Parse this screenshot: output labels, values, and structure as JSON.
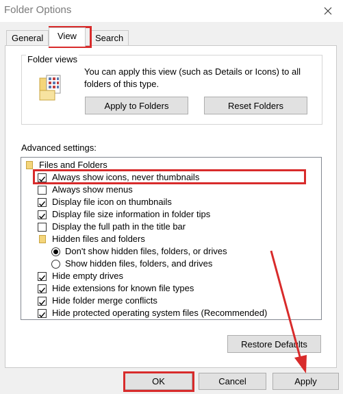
{
  "window": {
    "title": "Folder Options"
  },
  "tabs": [
    {
      "label": "General"
    },
    {
      "label": "View"
    },
    {
      "label": "Search"
    }
  ],
  "folder_views": {
    "legend": "Folder views",
    "description": "You can apply this view (such as Details or Icons) to all folders of this type.",
    "apply_button": "Apply to Folders",
    "reset_button": "Reset Folders"
  },
  "advanced": {
    "label": "Advanced settings:",
    "items": [
      {
        "type": "folder",
        "label": "Files and Folders"
      },
      {
        "type": "checkbox",
        "label": "Always show icons, never thumbnails",
        "checked": true
      },
      {
        "type": "checkbox",
        "label": "Always show menus",
        "checked": false
      },
      {
        "type": "checkbox",
        "label": "Display file icon on thumbnails",
        "checked": true
      },
      {
        "type": "checkbox",
        "label": "Display file size information in folder tips",
        "checked": true
      },
      {
        "type": "checkbox",
        "label": "Display the full path in the title bar",
        "checked": false
      },
      {
        "type": "folder",
        "label": "Hidden files and folders"
      },
      {
        "type": "radio",
        "label": "Don't show hidden files, folders, or drives",
        "checked": true
      },
      {
        "type": "radio",
        "label": "Show hidden files, folders, and drives",
        "checked": false
      },
      {
        "type": "checkbox",
        "label": "Hide empty drives",
        "checked": true
      },
      {
        "type": "checkbox",
        "label": "Hide extensions for known file types",
        "checked": true
      },
      {
        "type": "checkbox",
        "label": "Hide folder merge conflicts",
        "checked": true
      },
      {
        "type": "checkbox",
        "label": "Hide protected operating system files (Recommended)",
        "checked": true
      }
    ]
  },
  "restore_button": "Restore Defaults",
  "footer": {
    "ok": "OK",
    "cancel": "Cancel",
    "apply": "Apply"
  },
  "colors": {
    "highlight": "#d82b2b"
  }
}
